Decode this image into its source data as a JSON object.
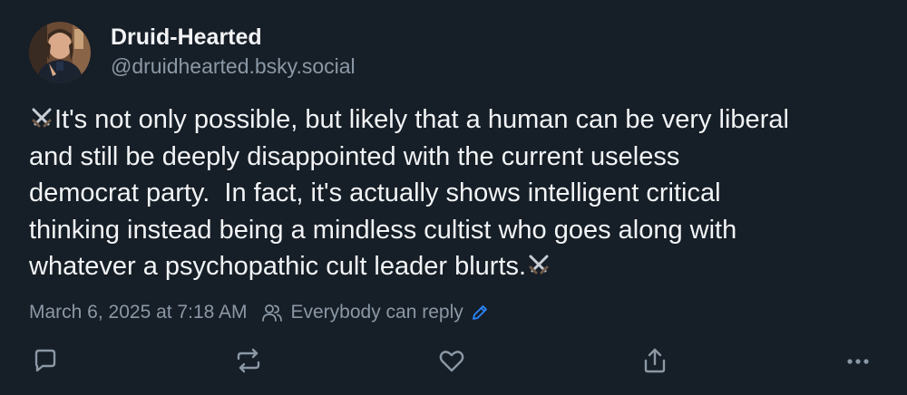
{
  "author": {
    "display_name": "Druid-Hearted",
    "handle": "@druidhearted.bsky.social",
    "avatar": "avatar-photo"
  },
  "post": {
    "lines": [
      "It's not only possible, but likely that a human can be very liberal",
      "and still be deeply disappointed with the current useless",
      "democrat party.  In fact, it's actually shows intelligent critical",
      "thinking instead being a mindless cultist who goes along with",
      "whatever a psychopathic cult leader blurts."
    ],
    "emoji": "crossed-swords-icon"
  },
  "meta": {
    "timestamp": "March 6, 2025 at 7:18 AM",
    "reply_setting": "Everybody can reply"
  },
  "actions": {
    "items": [
      "reply-icon",
      "repost-icon",
      "like-icon",
      "share-icon",
      "more-icon"
    ]
  },
  "colors": {
    "background": "#161e27",
    "text": "#f1f3f5",
    "muted": "#8b98a5",
    "accent": "#2b87ff"
  }
}
